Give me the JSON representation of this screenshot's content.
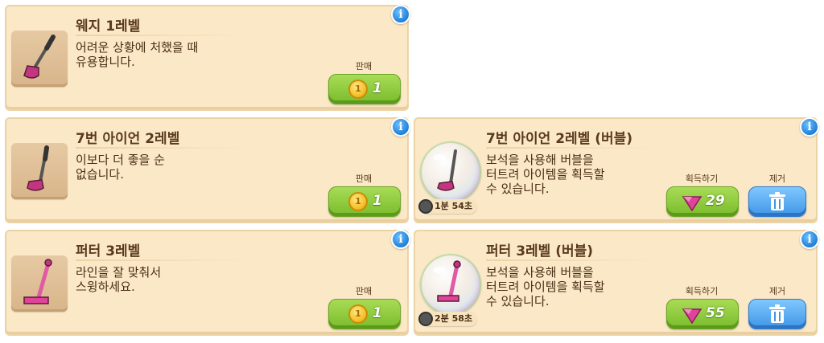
{
  "items": [
    {
      "title": "웨지 1레벨",
      "desc_lines": [
        "어려운 상황에 처했을 때",
        "유용합니다."
      ],
      "sell_label": "판매",
      "sell_price": "1",
      "icon": "wedge-club-icon"
    },
    {
      "title": "7번 아이언 2레벨",
      "desc_lines": [
        "이보다 더 좋을 순",
        "없습니다."
      ],
      "sell_label": "판매",
      "sell_price": "1",
      "icon": "iron-club-icon"
    },
    {
      "title": "퍼터 3레벨",
      "desc_lines": [
        "라인을 잘 맞춰서",
        "스윙하세요."
      ],
      "sell_label": "판매",
      "sell_price": "1",
      "icon": "putter-club-icon"
    }
  ],
  "bubbles": [
    {
      "title": "7번 아이언 2레벨 (버블)",
      "desc_lines": [
        "보석을 사용해 버블을",
        "터트려 아이템을 획득할",
        "수 있습니다."
      ],
      "timer": "1분 54초",
      "acquire_label": "획득하기",
      "acquire_price": "29",
      "remove_label": "제거",
      "icon": "iron-club-bubble-icon"
    },
    {
      "title": "퍼터 3레벨 (버블)",
      "desc_lines": [
        "보석을 사용해 버블을",
        "터트려 아이템을 획득할",
        "수 있습니다."
      ],
      "timer": "2분 58초",
      "acquire_label": "획득하기",
      "acquire_price": "55",
      "remove_label": "제거",
      "icon": "putter-club-bubble-icon"
    }
  ],
  "info_glyph": "i",
  "coin_glyph": "1",
  "colors": {
    "card_bg": "#fbe8c6",
    "green_button": "#8ccb3e",
    "blue_button": "#4aa0ec",
    "gem": "#e0449a",
    "club_pink": "#c2367f"
  }
}
